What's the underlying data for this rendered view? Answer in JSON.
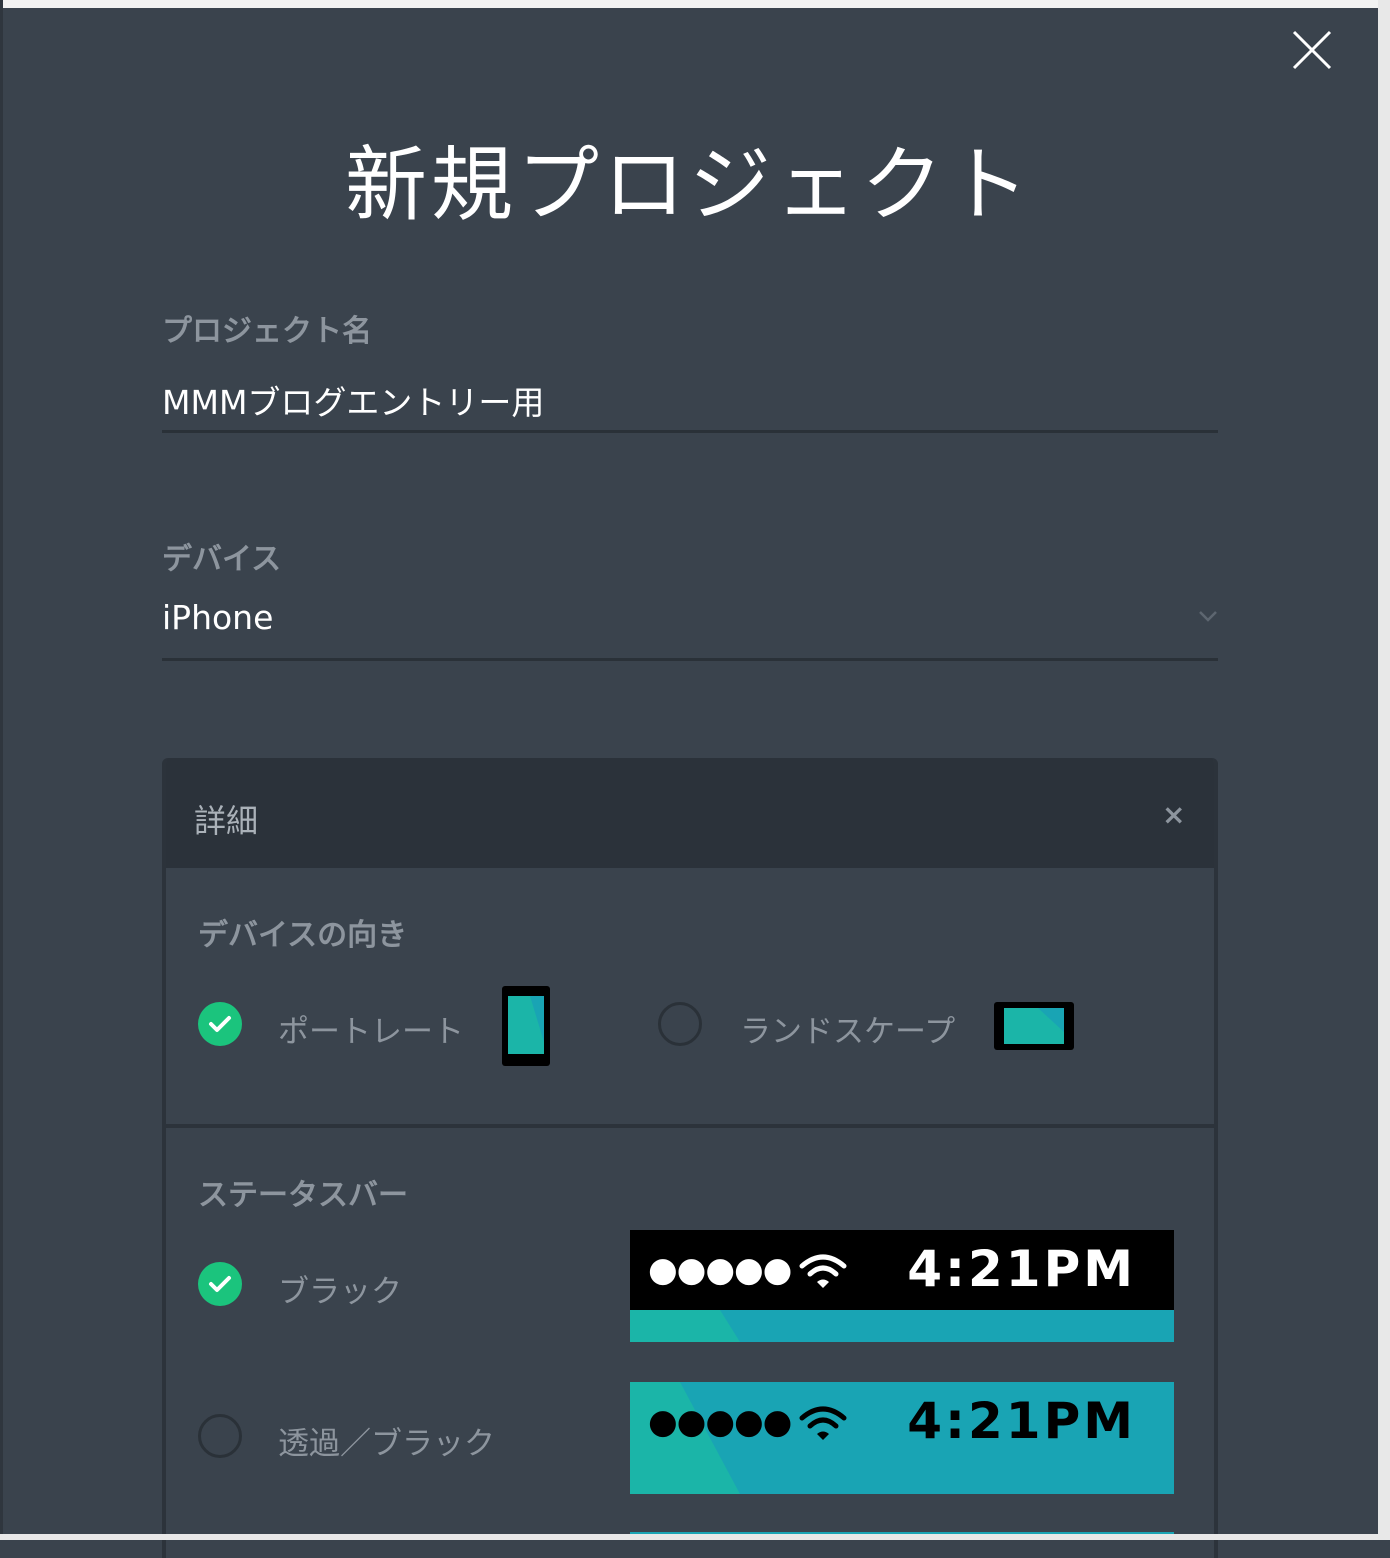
{
  "dialog": {
    "title": "新規プロジェクト",
    "close_icon": "close-icon"
  },
  "project_name": {
    "label": "プロジェクト名",
    "value": "MMMブログエントリー用"
  },
  "device": {
    "label": "デバイス",
    "value": "iPhone",
    "dropdown_icon": "chevron-down-icon"
  },
  "details": {
    "title": "詳細",
    "collapse_label": "×",
    "orientation": {
      "label": "デバイスの向き",
      "options": [
        {
          "label": "ポートレート",
          "selected": true,
          "icon": "portrait-phone-icon"
        },
        {
          "label": "ランドスケープ",
          "selected": false,
          "icon": "landscape-phone-icon"
        }
      ]
    },
    "status_bar": {
      "label": "ステータスバー",
      "options": [
        {
          "label": "ブラック",
          "selected": true,
          "preview_time": "4:21PM",
          "preview_signal": "●●●●●"
        },
        {
          "label": "透過／ブラック",
          "selected": false,
          "preview_time": "4:21PM",
          "preview_signal": "●●●●●"
        }
      ]
    }
  },
  "colors": {
    "background": "#3a434d",
    "accent_green": "#1bc47d",
    "teal": "#19a4b4",
    "teal_light": "#1bb5a8"
  }
}
